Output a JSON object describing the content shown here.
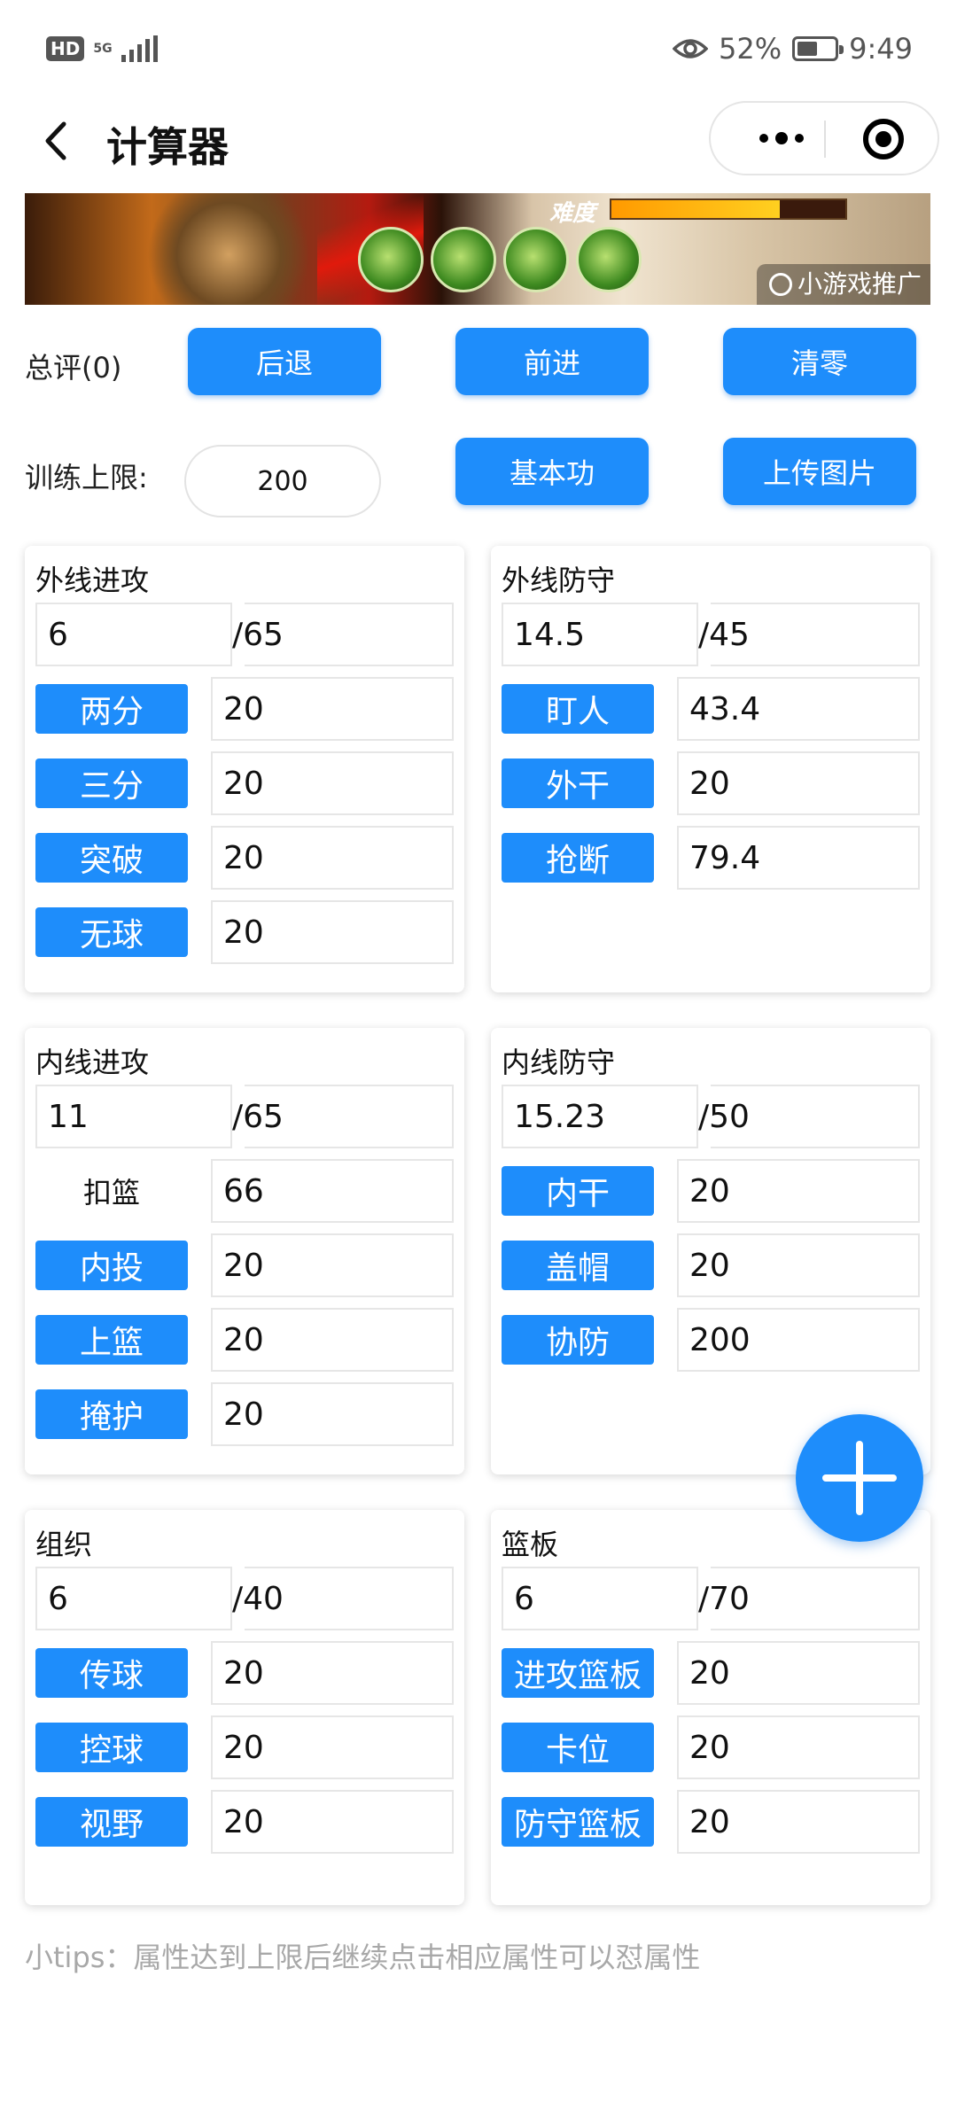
{
  "status_bar": {
    "hd": "HD",
    "network": "5G",
    "battery": "52%",
    "time": "9:49"
  },
  "nav": {
    "title": "计算器"
  },
  "banner": {
    "difficulty_label": "难度",
    "difficulty_level": 0.72,
    "promo_text": "小游戏推广"
  },
  "controls": {
    "total_label": "总评(0)",
    "back_button": "后退",
    "forward_button": "前进",
    "clear_button": "清零",
    "train_limit_label": "训练上限:",
    "train_limit_value": "200",
    "basic_button": "基本功",
    "upload_button": "上传图片"
  },
  "cards": {
    "outside_attack": {
      "title": "外线进攻",
      "value": "6",
      "max": "/65",
      "attrs": [
        {
          "label": "两分",
          "value": "20"
        },
        {
          "label": "三分",
          "value": "20"
        },
        {
          "label": "突破",
          "value": "20"
        },
        {
          "label": "无球",
          "value": "20"
        }
      ]
    },
    "outside_defense": {
      "title": "外线防守",
      "value": "14.5",
      "max": "/45",
      "attrs": [
        {
          "label": "盯人",
          "value": "43.4"
        },
        {
          "label": "外干",
          "value": "20"
        },
        {
          "label": "抢断",
          "value": "79.4"
        }
      ]
    },
    "inside_attack": {
      "title": "内线进攻",
      "value": "11",
      "max": "/65",
      "attrs": [
        {
          "label": "扣篮",
          "value": "66"
        },
        {
          "label": "内投",
          "value": "20"
        },
        {
          "label": "上篮",
          "value": "20"
        },
        {
          "label": "掩护",
          "value": "20"
        }
      ]
    },
    "inside_defense": {
      "title": "内线防守",
      "value": "15.23",
      "max": "/50",
      "attrs": [
        {
          "label": "内干",
          "value": "20"
        },
        {
          "label": "盖帽",
          "value": "20"
        },
        {
          "label": "协防",
          "value": "200"
        }
      ]
    },
    "organize": {
      "title": "组织",
      "value": "6",
      "max": "/40",
      "attrs": [
        {
          "label": "传球",
          "value": "20"
        },
        {
          "label": "控球",
          "value": "20"
        },
        {
          "label": "视野",
          "value": "20"
        }
      ]
    },
    "rebound": {
      "title": "篮板",
      "value": "6",
      "max": "/70",
      "attrs": [
        {
          "label": "进攻篮板",
          "value": "20"
        },
        {
          "label": "卡位",
          "value": "20"
        },
        {
          "label": "防守篮板",
          "value": "20"
        }
      ]
    }
  },
  "tips": "小tips：属性达到上限后继续点击相应属性可以怼属性",
  "colors": {
    "accent": "#1e8dfb",
    "tips": "#a8a8a8"
  }
}
